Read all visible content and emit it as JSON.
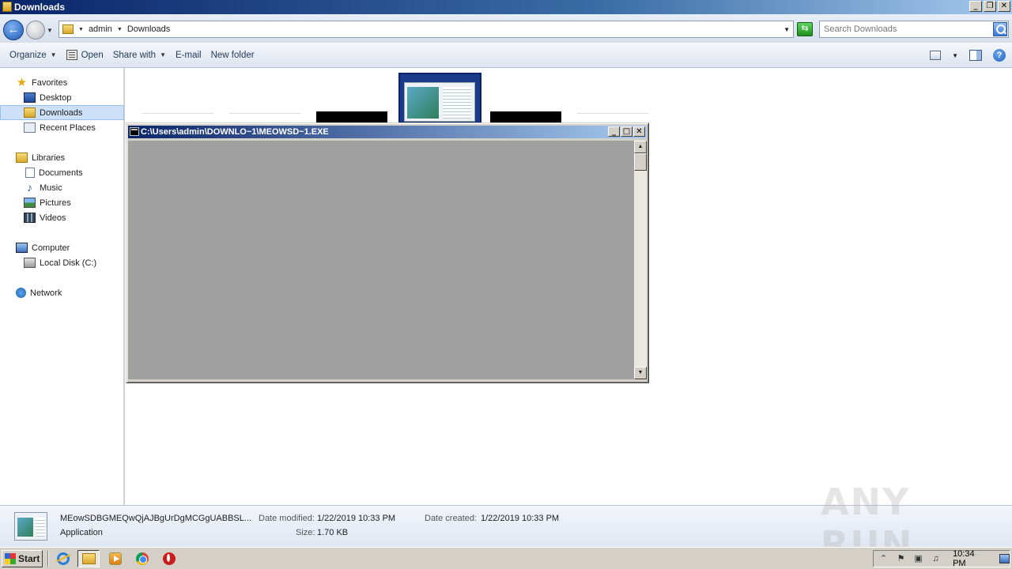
{
  "window": {
    "title": "Downloads",
    "minimize": "_",
    "restore": "❐",
    "close": "✕"
  },
  "address": {
    "crumbs": [
      "admin",
      "Downloads"
    ],
    "search_placeholder": "Search Downloads"
  },
  "toolbar": {
    "organize": "Organize",
    "open": "Open",
    "share_with": "Share with",
    "email": "E-mail",
    "new_folder": "New folder"
  },
  "sidebar": {
    "favorites": "Favorites",
    "desktop": "Desktop",
    "downloads": "Downloads",
    "recent_places": "Recent Places",
    "libraries": "Libraries",
    "documents": "Documents",
    "music": "Music",
    "pictures": "Pictures",
    "videos": "Videos",
    "computer": "Computer",
    "local_disk": "Local Disk (C:)",
    "network": "Network"
  },
  "console": {
    "title": "C:\\Users\\admin\\DOWNLO~1\\MEOWSD~1.EXE"
  },
  "details": {
    "filename": "MEowSDBGMEQwQjAJBgUrDgMCGgUABBSL...",
    "type": "Application",
    "date_modified_label": "Date modified:",
    "date_modified": "1/22/2019 10:33 PM",
    "date_created_label": "Date created:",
    "date_created": "1/22/2019 10:33 PM",
    "size_label": "Size:",
    "size": "1.70 KB"
  },
  "watermark": "ANY RUN",
  "taskbar": {
    "start": "Start",
    "clock": "10:34 PM"
  },
  "icons": {
    "back": "arrow-left-icon",
    "forward": "arrow-right-icon",
    "search": "search-icon",
    "help": "help-icon"
  }
}
